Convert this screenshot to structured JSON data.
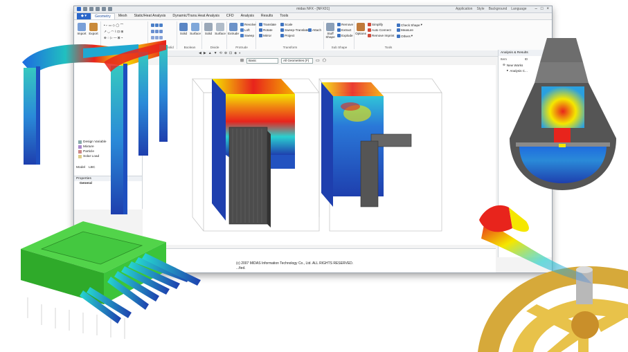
{
  "window": {
    "title": "midas NFX - [NFX01]",
    "right_menu": [
      "Application",
      "Style",
      "Background",
      "Language"
    ],
    "controls": [
      "minimize",
      "maximize",
      "close"
    ]
  },
  "tabs": [
    "Geometry",
    "Mesh",
    "Static/Heat Analysis",
    "Dynamic/Trans.Heat Analysis",
    "CFD",
    "Analysis",
    "Results",
    "Tools"
  ],
  "ribbon": {
    "file": {
      "label": "File",
      "buttons": [
        "Import",
        "Export"
      ]
    },
    "point_curve": {
      "label": "Point & Curve"
    },
    "surface_solid": {
      "label": "Surface & Solid"
    },
    "boolean": {
      "label": "Boolean",
      "buttons": [
        "Solid",
        "Surface"
      ]
    },
    "divide": {
      "label": "Divide",
      "buttons": [
        "Solid",
        "Surface"
      ]
    },
    "protrude": {
      "label": "Protrude",
      "big": "Extrude",
      "items": [
        "Revolve",
        "Loft",
        "Sweep"
      ]
    },
    "transform": {
      "label": "Transform",
      "items": [
        "Translate",
        "Rotate",
        "Mirror",
        "Scale",
        "Sweep-Translate",
        "Project",
        "Attach"
      ]
    },
    "sub_shape": {
      "label": "Sub Shape",
      "big": "Stuff Shape",
      "items": [
        "Remove",
        "Extract",
        "Explode"
      ]
    },
    "tools": {
      "label": "Tools",
      "big": "Options",
      "items": [
        "Simplify",
        "Auto Connect",
        "Remove Imprint",
        "Check Shape",
        "Measure",
        "Others"
      ]
    }
  },
  "view_toolbar": {
    "selector_1": "Basic",
    "selector_2": "All Geometries (F)"
  },
  "left_panel": {
    "tree_items": [
      "Design Variable",
      "Mixture",
      "Particle",
      "Solar Load"
    ],
    "bottom_tabs": [
      "Model",
      "LBC"
    ],
    "properties_title": "Properties",
    "properties_group": "General"
  },
  "right_panel": {
    "title": "Analysis & Results",
    "columns": [
      "Item",
      "ID",
      "C..."
    ],
    "items": [
      "New Works",
      "Analysis C..."
    ]
  },
  "output": {
    "lines": [
      "(c) 2007 MIDAS Information Technology Co., Ltd. ALL RIGHTS RESERVED.",
      "...fied."
    ]
  },
  "colors": {
    "app_tab": "#2a66c9",
    "hot": "#e8241c",
    "mid": "#f5e700",
    "cool": "#1e3fae",
    "gear": "#e8c24a",
    "plate": "#3cc43a"
  }
}
